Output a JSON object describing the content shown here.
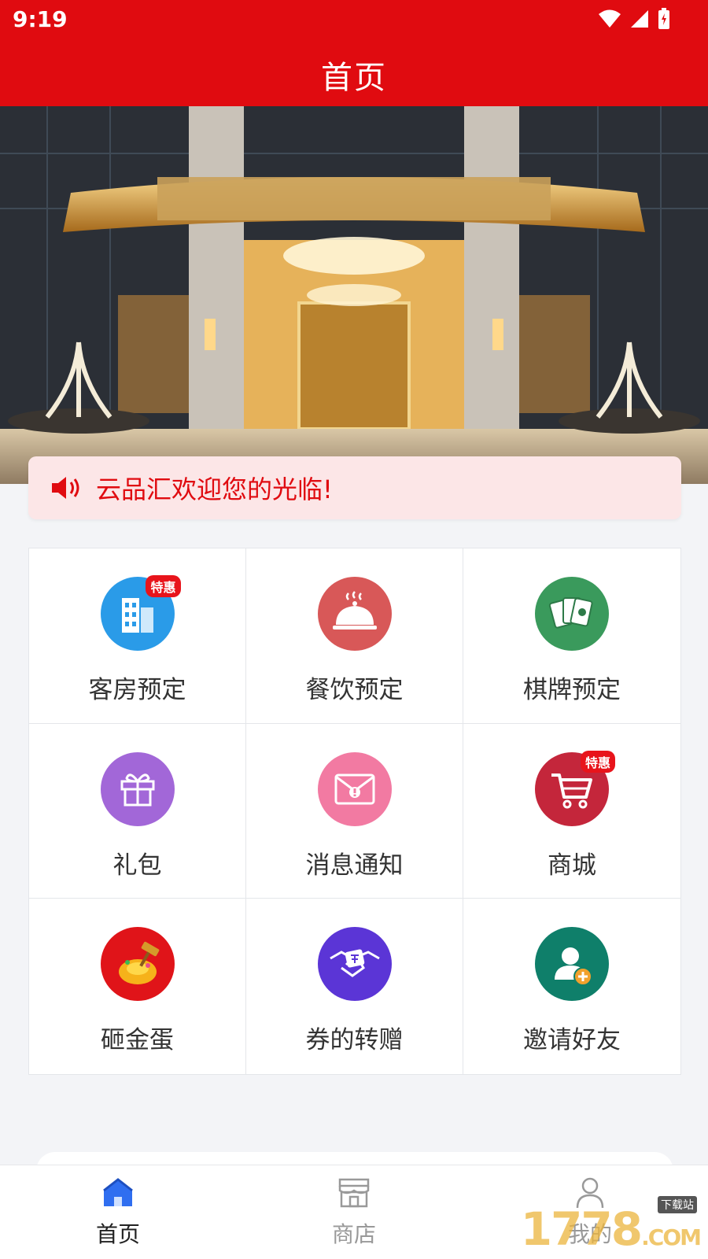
{
  "status_bar": {
    "time": "9:19"
  },
  "header": {
    "title": "首页"
  },
  "notice": {
    "text": "云品汇欢迎您的光临!"
  },
  "grid": {
    "items": [
      {
        "label": "客房预定",
        "icon": "hotel-building-icon",
        "color": "#2a9be8",
        "badge": "特惠"
      },
      {
        "label": "餐饮预定",
        "icon": "dining-cloche-icon",
        "color": "#d85858",
        "badge": ""
      },
      {
        "label": "棋牌预定",
        "icon": "playing-cards-icon",
        "color": "#3a9a5c",
        "badge": ""
      },
      {
        "label": "礼包",
        "icon": "gift-box-icon",
        "color": "#a267d8",
        "badge": ""
      },
      {
        "label": "消息通知",
        "icon": "message-envelope-icon",
        "color": "#f27aa2",
        "badge": ""
      },
      {
        "label": "商城",
        "icon": "shopping-cart-icon",
        "color": "#c4263b",
        "badge": "特惠"
      },
      {
        "label": "砸金蛋",
        "icon": "golden-egg-hammer-icon",
        "color": "#e01419",
        "badge": ""
      },
      {
        "label": "券的转赠",
        "icon": "coupon-handshake-icon",
        "color": "#5b35d6",
        "badge": ""
      },
      {
        "label": "邀请好友",
        "icon": "invite-friend-icon",
        "color": "#0f7f6a",
        "badge": ""
      }
    ]
  },
  "tabbar": {
    "items": [
      {
        "label": "首页",
        "icon": "home-icon",
        "active": true
      },
      {
        "label": "商店",
        "icon": "store-icon",
        "active": false
      },
      {
        "label": "我的",
        "icon": "profile-icon",
        "active": false
      }
    ]
  },
  "watermark": {
    "text": "1778",
    "sub": "下载站",
    "tail": ".COM"
  },
  "colors": {
    "primary": "#e00b10",
    "notice_bg": "#fce6e7",
    "page_bg": "#f3f4f7"
  }
}
